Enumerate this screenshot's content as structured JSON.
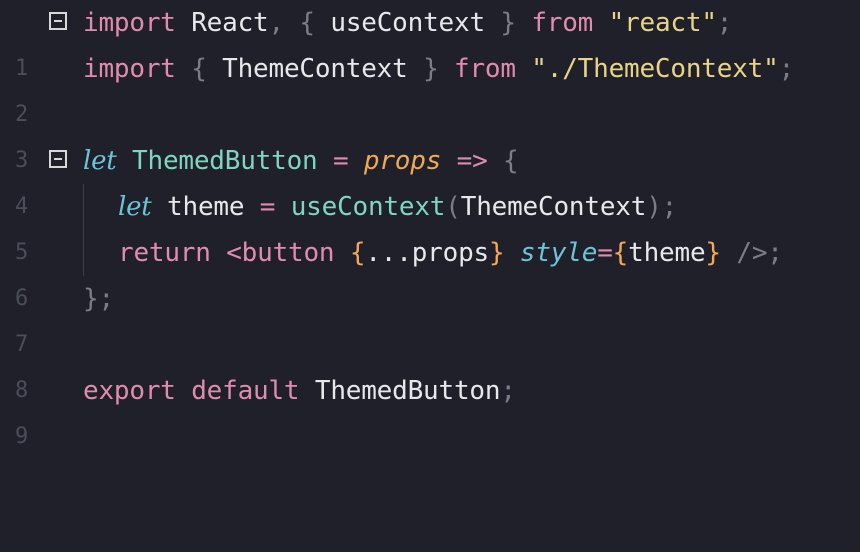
{
  "editor": {
    "background": "#1f2029",
    "lines": [
      {
        "number": "1",
        "text": "import React, { useContext } from \"react\";"
      },
      {
        "number": "2",
        "text": "import { ThemeContext } from \"./ThemeContext\";"
      },
      {
        "number": "3",
        "text": ""
      },
      {
        "number": "4",
        "text": "let ThemedButton = props => {"
      },
      {
        "number": "5",
        "text": "let theme = useContext(ThemeContext);"
      },
      {
        "number": "6",
        "text": "return <button {...props} style={theme} />;"
      },
      {
        "number": "7",
        "text": "};"
      },
      {
        "number": "8",
        "text": ""
      },
      {
        "number": "9",
        "text": "export default ThemedButton;"
      }
    ],
    "tokens": {
      "import": "import",
      "react_id": "React",
      "comma": ",",
      "lbrace": "{",
      "rbrace": "}",
      "useContext": "useContext",
      "from": "from",
      "react_str": "\"react\"",
      "semi": ";",
      "ThemeContext": "ThemeContext",
      "theme_path_str": "\"./ThemeContext\"",
      "let": "let",
      "ThemedButton": "ThemedButton",
      "eq": "=",
      "props": "props",
      "arrow": "=>",
      "theme": "theme",
      "lparen": "(",
      "rparen": ")",
      "return": "return",
      "button_open": "<button",
      "spread": "...",
      "style": "style",
      "close_tag": "/>",
      "close_block": "};",
      "export": "export",
      "default": "default"
    },
    "fold_icon": "collapse-square-icon",
    "colors": {
      "keyword": "#e08cb0",
      "identifier": "#e8e8ec",
      "string": "#e8d487",
      "let": "#6cc4d8",
      "class_name": "#7fd6c0",
      "param": "#f2a955",
      "punctuation": "#7a7d88",
      "line_number": "#4a4d5a"
    }
  }
}
